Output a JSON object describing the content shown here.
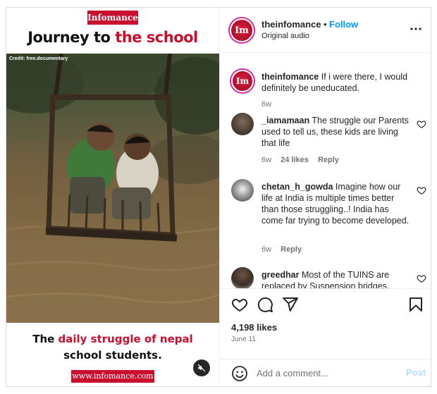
{
  "media": {
    "brand_tag": "Infomance",
    "headline_prefix": "Journey to ",
    "headline_highlight": "the school",
    "credit": "Credit: free.documentary",
    "caption_prefix": "The ",
    "caption_highlight": "daily struggle of nepal",
    "caption_suffix": "school students.",
    "url": "www.infomance.com",
    "mute_icon": "speaker-muted-icon"
  },
  "header": {
    "username": "theinfomance",
    "separator": "•",
    "follow_label": "Follow",
    "audio_label": "Original audio",
    "avatar_text": "Im",
    "more_label": "•••"
  },
  "caption_post": {
    "username": "theinfomance",
    "text": "If i were there, I would definitely be uneducated.",
    "time": "6w"
  },
  "comments": [
    {
      "username": "_iamamaan",
      "text": "The struggle our Parents used to tell us, these kids are living that life",
      "time": "6w",
      "likes": "24 likes",
      "reply": "Reply"
    },
    {
      "username": "chetan_h_gowda",
      "text": "Imagine how our life at India is multiple times better than those struggling..! India has come far trying to become developed.",
      "time": "6w",
      "likes": "",
      "reply": "Reply"
    },
    {
      "username": "greedhar",
      "text": "Most of the TUINS are replaced by Suspension bridges.",
      "time": "",
      "likes": "",
      "reply": ""
    }
  ],
  "actions": {
    "like_icon": "heart-icon",
    "comment_icon": "comment-icon",
    "share_icon": "share-icon",
    "save_icon": "bookmark-icon",
    "likes": "4,198 likes",
    "date": "June 11"
  },
  "add_comment": {
    "placeholder": "Add a comment...",
    "post_label": "Post",
    "emoji_icon": "emoji-icon"
  },
  "colors": {
    "brand_red": "#c8102e",
    "link_blue": "#0095f6",
    "post_disabled": "#b2dffc",
    "muted_text": "#737373"
  }
}
